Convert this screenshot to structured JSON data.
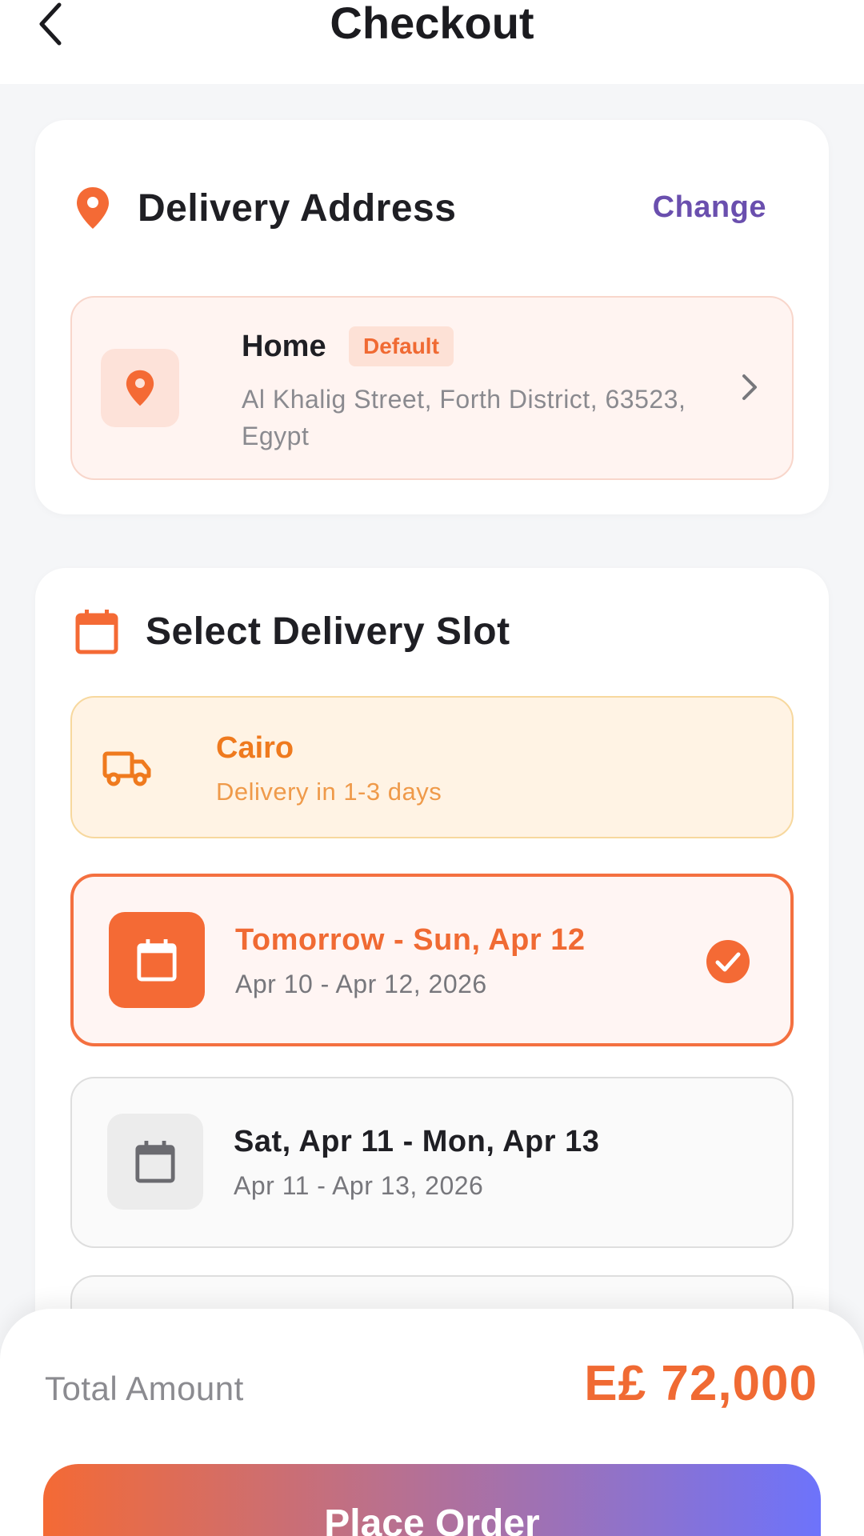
{
  "header": {
    "title": "Checkout",
    "back_icon": "chevron-left-icon"
  },
  "address_section": {
    "title": "Delivery Address",
    "change_label": "Change",
    "address": {
      "name": "Home",
      "badge": "Default",
      "line": "Al Khalig Street, Forth District, 63523, Egypt"
    }
  },
  "slot_section": {
    "title": "Select Delivery Slot",
    "region": {
      "city": "Cairo",
      "delivery_time": "Delivery in 1-3 days"
    },
    "slots": [
      {
        "title": "Tomorrow - Sun, Apr 12",
        "range": "Apr 10 - Apr 12, 2026",
        "selected": true
      },
      {
        "title": "Sat, Apr 11 - Mon, Apr 13",
        "range": "Apr 11 - Apr 13, 2026",
        "selected": false
      }
    ]
  },
  "footer": {
    "total_label": "Total Amount",
    "total_value": "E£ 72,000",
    "place_order_label": "Place Order"
  },
  "colors": {
    "accent": "#f06a33",
    "link": "#6a4fae",
    "gradient_start": "#f46a35",
    "gradient_end": "#6d73fb"
  }
}
